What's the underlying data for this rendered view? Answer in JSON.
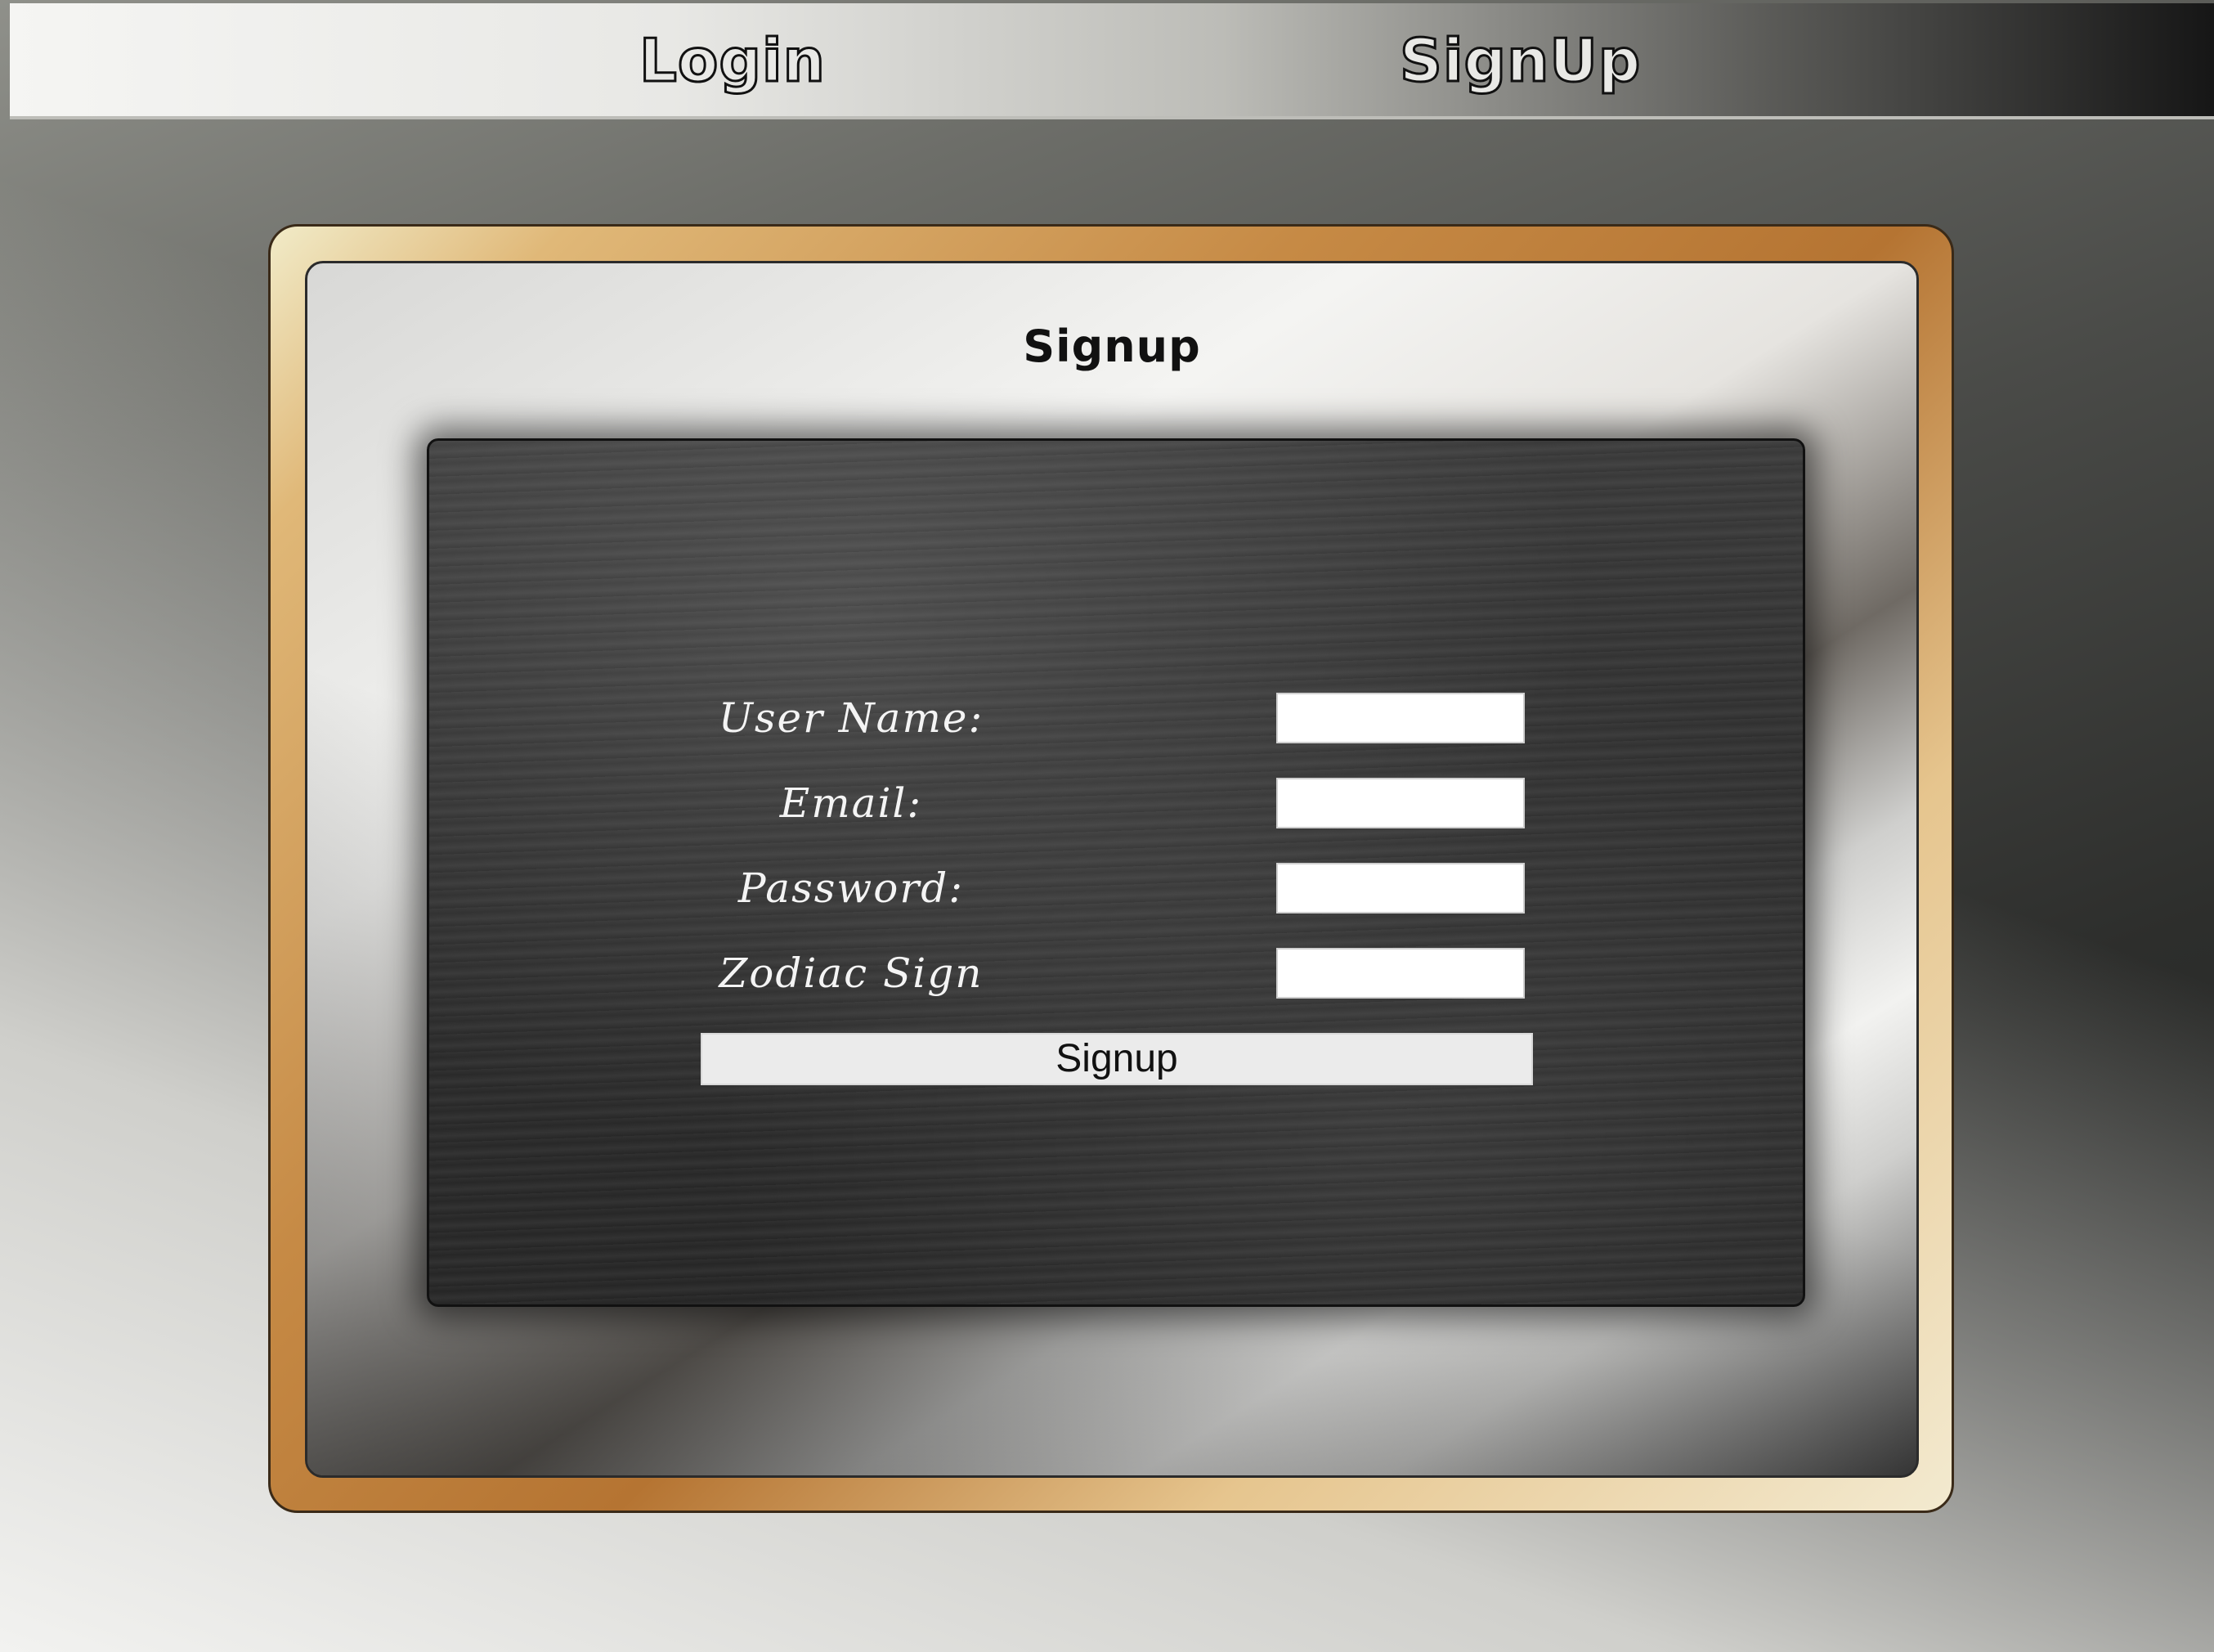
{
  "nav": {
    "login_label": "Login",
    "signup_label": "SignUp"
  },
  "page": {
    "title": "Signup"
  },
  "form": {
    "fields": [
      {
        "label": "User Name:",
        "value": ""
      },
      {
        "label": "Email:",
        "value": ""
      },
      {
        "label": "Password:",
        "value": ""
      },
      {
        "label": "Zodiac Sign",
        "value": ""
      }
    ],
    "submit_label": "Signup"
  },
  "colors": {
    "frame_accent": "#c68a45",
    "chalkboard": "#2f2f2f",
    "chalk_text": "#f4f4f4"
  }
}
